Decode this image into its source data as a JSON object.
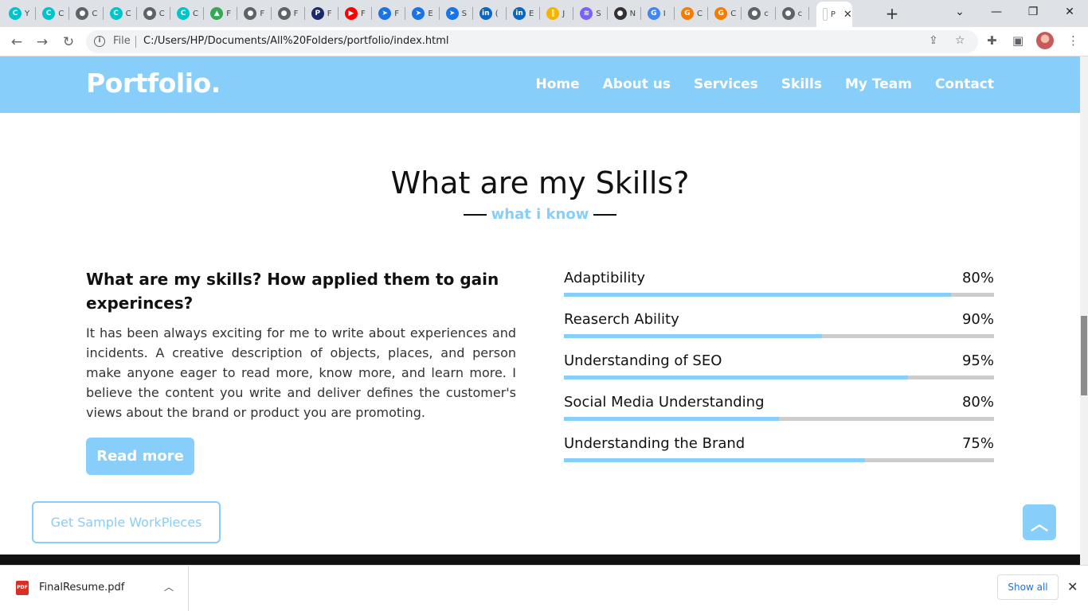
{
  "browser": {
    "tabs": [
      {
        "label": "Y",
        "icon": "canva-icon",
        "color": "#00c4cc",
        "glyph": "C"
      },
      {
        "label": "C",
        "icon": "canva-icon",
        "color": "#00c4cc",
        "glyph": "C"
      },
      {
        "label": "C",
        "icon": "globe-icon",
        "color": "#5f6368",
        "glyph": "●"
      },
      {
        "label": "C",
        "icon": "canva-icon",
        "color": "#00c4cc",
        "glyph": "C"
      },
      {
        "label": "C",
        "icon": "globe-icon",
        "color": "#5f6368",
        "glyph": "●"
      },
      {
        "label": "C",
        "icon": "canva-icon",
        "color": "#00c4cc",
        "glyph": "C"
      },
      {
        "label": "F",
        "icon": "drive-icon",
        "color": "#34a853",
        "glyph": "▲"
      },
      {
        "label": "F",
        "icon": "globe-icon",
        "color": "#5f6368",
        "glyph": "●"
      },
      {
        "label": "F",
        "icon": "globe-icon",
        "color": "#5f6368",
        "glyph": "●"
      },
      {
        "label": "F",
        "icon": "p-icon",
        "color": "#1b2a6b",
        "glyph": "P"
      },
      {
        "label": "F",
        "icon": "youtube-icon",
        "color": "#ff0000",
        "glyph": "▶"
      },
      {
        "label": "F",
        "icon": "arrow-app-icon",
        "color": "#1a73e8",
        "glyph": "➤"
      },
      {
        "label": "E",
        "icon": "arrow-app-icon",
        "color": "#1a73e8",
        "glyph": "➤"
      },
      {
        "label": "S",
        "icon": "arrow-app-icon",
        "color": "#1a73e8",
        "glyph": "➤"
      },
      {
        "label": "(",
        "icon": "linkedin-icon",
        "color": "#0a66c2",
        "glyph": "in"
      },
      {
        "label": "E",
        "icon": "linkedin-icon",
        "color": "#0a66c2",
        "glyph": "in"
      },
      {
        "label": "J",
        "icon": "bars-icon",
        "color": "#f4b400",
        "glyph": "‖"
      },
      {
        "label": "S",
        "icon": "wave-icon",
        "color": "#7b61ff",
        "glyph": "≋"
      },
      {
        "label": "N",
        "icon": "github-icon",
        "color": "#333333",
        "glyph": "●"
      },
      {
        "label": "I",
        "icon": "google-icon",
        "color": "#4285f4",
        "glyph": "G"
      },
      {
        "label": "C",
        "icon": "orange-app-icon",
        "color": "#f57c00",
        "glyph": "G"
      },
      {
        "label": "C",
        "icon": "orange-app-icon",
        "color": "#f57c00",
        "glyph": "G"
      },
      {
        "label": "c",
        "icon": "globe-icon",
        "color": "#5f6368",
        "glyph": "●"
      },
      {
        "label": "c",
        "icon": "globe-icon",
        "color": "#5f6368",
        "glyph": "●"
      },
      {
        "label": "P",
        "icon": "page-icon",
        "color": "#ffffff",
        "glyph": ""
      }
    ],
    "new_tab": "+",
    "file_label": "File",
    "url": "C:/Users/HP/Documents/All%20Folders/portfolio/index.html"
  },
  "site": {
    "logo": "Portfolio.",
    "nav": [
      "Home",
      "About us",
      "Services",
      "Skills",
      "My Team",
      "Contact"
    ],
    "section_title": "What are my Skills?",
    "section_subtitle": "what i know",
    "left_heading": "What are my skills? How applied them to gain experinces?",
    "left_paragraph": "It has been always exciting for me to write about experiences and incidents. A creative description of objects, places, and person make anyone eager to read more, know more, and learn more. I believe the content you write and deliver defines the customer's views about the brand or product you are promoting.",
    "read_more": "Read more",
    "skills": [
      {
        "name": "Adaptibility",
        "percent_label": "80%",
        "bar_fill": 0.9
      },
      {
        "name": "Reaserch Ability",
        "percent_label": "90%",
        "bar_fill": 0.6
      },
      {
        "name": "Understanding of SEO",
        "percent_label": "95%",
        "bar_fill": 0.8
      },
      {
        "name": "Social Media Understanding",
        "percent_label": "80%",
        "bar_fill": 0.5
      },
      {
        "name": "Understanding the Brand",
        "percent_label": "75%",
        "bar_fill": 0.7
      }
    ],
    "sample_button": "Get Sample WorkPieces",
    "accent_color": "#87cefa"
  },
  "downloads": {
    "file_name": "FinalResume.pdf",
    "file_type": "PDF",
    "show_all": "Show all"
  }
}
